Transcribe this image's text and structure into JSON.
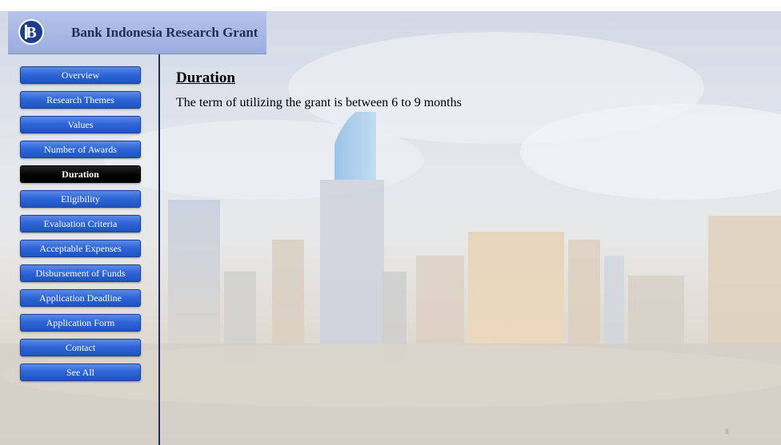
{
  "header": {
    "title": "Bank Indonesia Research Grant",
    "logo": "bank-indonesia-logo",
    "colors": {
      "banner": "#a8b8e6",
      "title_text": "#1d2d5a",
      "logo_bg": "#1d3d8f"
    }
  },
  "sidebar": {
    "items": [
      {
        "label": "Overview"
      },
      {
        "label": "Research Themes"
      },
      {
        "label": "Values"
      },
      {
        "label": "Number of Awards"
      },
      {
        "label": "Duration",
        "active": true
      },
      {
        "label": "Eligibility"
      },
      {
        "label": "Evaluation Criteria"
      },
      {
        "label": "Acceptable Expenses"
      },
      {
        "label": "Disbursement of Funds"
      },
      {
        "label": "Application Deadline"
      },
      {
        "label": "Application Form"
      },
      {
        "label": "Contact"
      },
      {
        "label": "See All"
      }
    ],
    "colors": {
      "button": "#2f66d8",
      "active_button": "#000000",
      "divider": "#1b2d6b"
    }
  },
  "main": {
    "heading": "Duration",
    "body": "The term of utilizing the grant is between 6 to 9 months"
  },
  "footer": {
    "page_number": "8"
  }
}
